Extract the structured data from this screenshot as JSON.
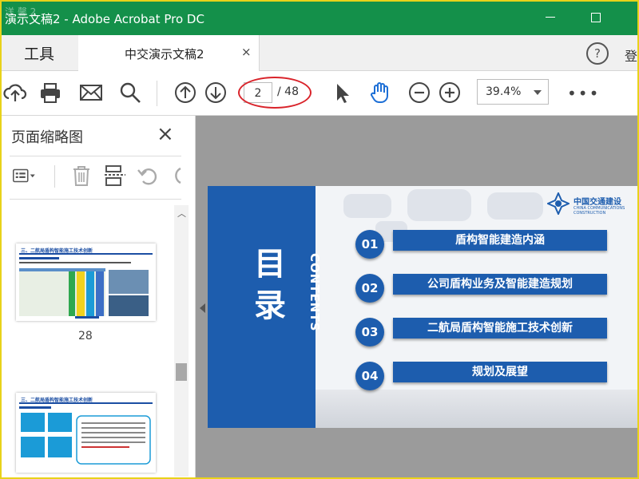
{
  "window": {
    "title": "演示文稿2 - Adobe Acrobat Pro DC",
    "watermark": "洋 馨 2"
  },
  "tabs": {
    "tools": "工具",
    "document": "中交演示文稿2",
    "close_symbol": "×",
    "help_symbol": "?",
    "sign_in": "登"
  },
  "toolbar": {
    "current_page": "2",
    "total_pages": "/ 48",
    "zoom": "39.4%",
    "more": "•••",
    "icons": [
      "upload-icon",
      "print-icon",
      "mail-icon",
      "search-icon",
      "page-up-icon",
      "page-down-icon",
      "select-arrow-icon",
      "hand-icon",
      "zoom-out-icon",
      "zoom-in-icon"
    ]
  },
  "sidebar": {
    "title": "页面缩略图",
    "close_symbol": "×",
    "thumbnails": [
      {
        "page_label": "28",
        "header": "三、二航局盾构智能施工技术创新"
      },
      {
        "header": "三、二航局盾构智能施工技术创新"
      }
    ]
  },
  "slide": {
    "heading": "目录",
    "heading_vertical": "CONTENTS",
    "logo_name": "中国交通建设",
    "logo_sub": "CHINA COMMUNICATIONS CONSTRUCTION",
    "items": [
      {
        "number": "01",
        "label": "盾构智能建造内涵"
      },
      {
        "number": "02",
        "label": "公司盾构业务及智能建造规划"
      },
      {
        "number": "03",
        "label": "二航局盾构智能施工技术创新"
      },
      {
        "number": "04",
        "label": "规划及展望"
      }
    ]
  },
  "colors": {
    "titlebar": "#14904a",
    "slide_blue": "#1d5dae",
    "annotation_red": "#d9232a",
    "hand_active": "#1d6fd6"
  }
}
